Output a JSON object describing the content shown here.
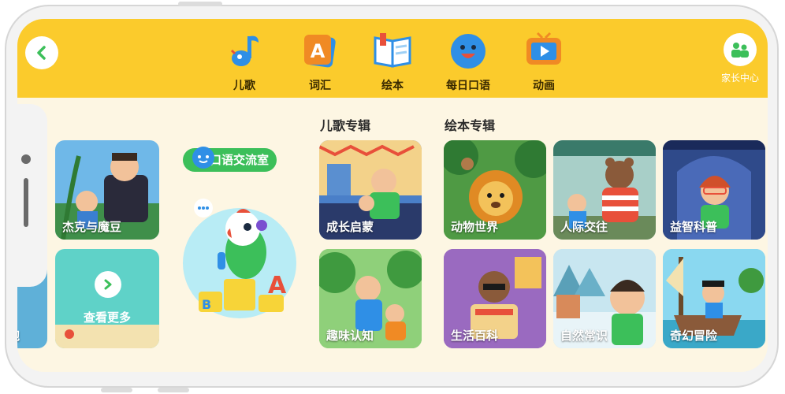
{
  "header": {
    "nav": [
      {
        "label": "儿歌",
        "icon": "music-note-icon"
      },
      {
        "label": "词汇",
        "icon": "letter-a-icon"
      },
      {
        "label": "绘本",
        "icon": "book-icon"
      },
      {
        "label": "每日口语",
        "icon": "smiley-face-icon"
      },
      {
        "label": "动画",
        "icon": "tv-play-icon"
      }
    ],
    "parent_center_label": "家长中心"
  },
  "left_cards": [
    {
      "label": "杰克与魔豆"
    },
    {
      "label": "查看更多"
    },
    {
      "label": "鲍"
    }
  ],
  "oral_room": {
    "label": "口语交流室"
  },
  "sections": {
    "songs_title": "儿歌专辑",
    "books_title": "绘本专辑"
  },
  "song_albums": [
    {
      "label": "成长启蒙"
    },
    {
      "label": "趣味认知"
    }
  ],
  "book_albums": [
    {
      "label": "动物世界"
    },
    {
      "label": "人际交往"
    },
    {
      "label": "益智科普"
    },
    {
      "label": "生活百科"
    },
    {
      "label": "自然常识"
    },
    {
      "label": "奇幻冒险"
    }
  ],
  "colors": {
    "header_yellow": "#fbcb2c",
    "background_cream": "#fdf6e3",
    "accent_green": "#3cbf5a"
  }
}
